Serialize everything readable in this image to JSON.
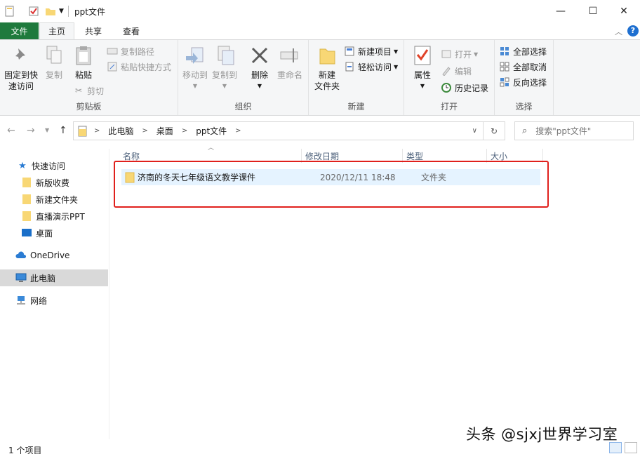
{
  "window": {
    "title": "ppt文件",
    "minimize": "—",
    "maximize": "☐",
    "close": "✕"
  },
  "tabs": {
    "file": "文件",
    "home": "主页",
    "share": "共享",
    "view": "查看"
  },
  "ribbon": {
    "clipboard": {
      "label": "剪贴板",
      "pin": "固定到快速访问",
      "pin_line1": "固定到快",
      "pin_line2": "速访问",
      "copy": "复制",
      "paste": "粘贴",
      "copy_path": "复制路径",
      "paste_shortcut": "粘贴快捷方式",
      "cut": "剪切"
    },
    "organize": {
      "label": "组织",
      "move_to": "移动到",
      "copy_to": "复制到",
      "delete": "删除",
      "rename": "重命名"
    },
    "new": {
      "label": "新建",
      "new_folder_line1": "新建",
      "new_folder_line2": "文件夹",
      "new_item": "新建项目",
      "easy_access": "轻松访问"
    },
    "open": {
      "label": "打开",
      "properties": "属性",
      "open": "打开",
      "edit": "编辑",
      "history": "历史记录"
    },
    "select": {
      "label": "选择",
      "select_all": "全部选择",
      "select_none": "全部取消",
      "invert": "反向选择"
    }
  },
  "address": {
    "crumbs": [
      "此电脑",
      "桌面",
      "ppt文件"
    ],
    "search_placeholder": "搜索\"ppt文件\""
  },
  "navpane": {
    "quick_access": "快速访问",
    "items": [
      "新版收费",
      "新建文件夹",
      "直播演示PPT",
      "桌面"
    ],
    "onedrive": "OneDrive",
    "this_pc": "此电脑",
    "network": "网络"
  },
  "columns": {
    "name": "名称",
    "modified": "修改日期",
    "type": "类型",
    "size": "大小"
  },
  "files": [
    {
      "name": "济南的冬天七年级语文教学课件",
      "modified": "2020/12/11 18:48",
      "type": "文件夹",
      "size": ""
    }
  ],
  "status": {
    "count": "1 个项目"
  },
  "watermark": "头条 @sjxj世界学习室",
  "colors": {
    "file_tab": "#1f7a3d",
    "selection": "#e5f3ff",
    "highlight_box": "#e0201c",
    "folder": "#f8d775"
  }
}
